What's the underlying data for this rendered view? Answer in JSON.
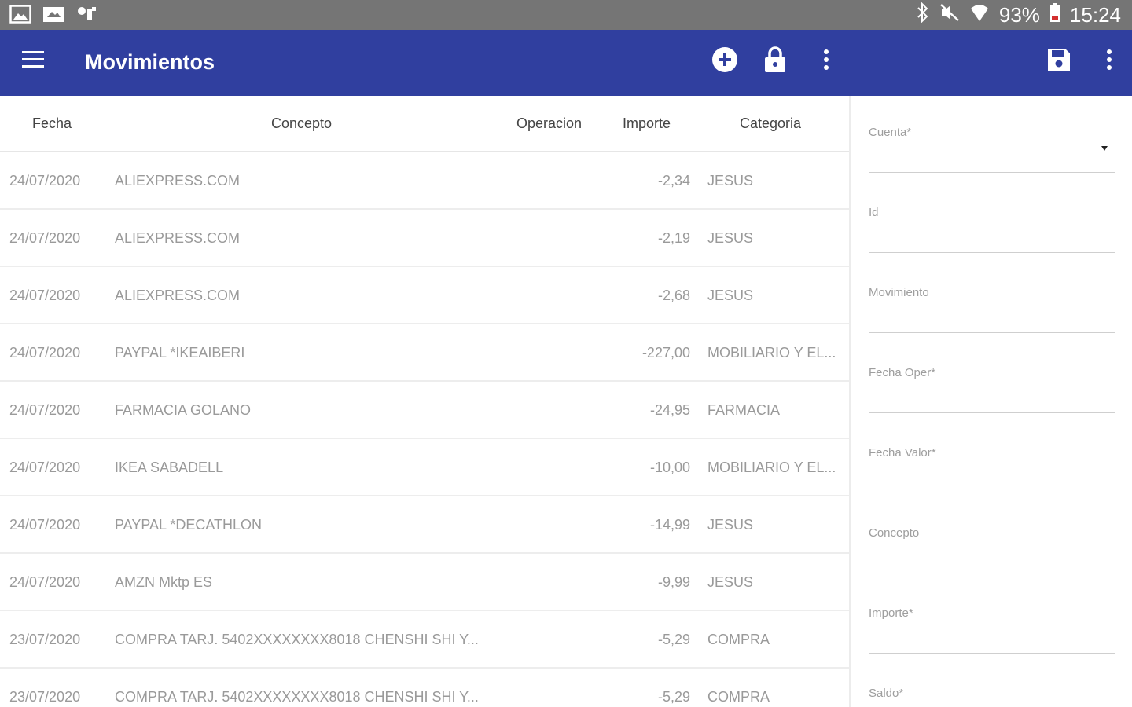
{
  "status_bar": {
    "battery": "93%",
    "time": "15:24",
    "left_icons": [
      "gallery-icon",
      "photo-icon",
      "sync-icon"
    ],
    "right_icons": [
      "bluetooth-icon",
      "mute-icon",
      "wifi-icon",
      "battery-icon"
    ]
  },
  "app_bar": {
    "title": "Movimientos",
    "color": "#303F9F",
    "actions": [
      "add-icon",
      "lock-icon",
      "more-icon",
      "save-icon",
      "more-icon"
    ]
  },
  "table": {
    "headers": {
      "fecha": "Fecha",
      "concepto": "Concepto",
      "operacion": "Operacion",
      "importe": "Importe",
      "categoria": "Categoria"
    },
    "rows": [
      {
        "fecha": "24/07/2020",
        "concepto": "ALIEXPRESS.COM",
        "importe": "-2,34",
        "categoria": "JESUS"
      },
      {
        "fecha": "24/07/2020",
        "concepto": "ALIEXPRESS.COM",
        "importe": "-2,19",
        "categoria": "JESUS"
      },
      {
        "fecha": "24/07/2020",
        "concepto": "ALIEXPRESS.COM",
        "importe": "-2,68",
        "categoria": "JESUS"
      },
      {
        "fecha": "24/07/2020",
        "concepto": "PAYPAL *IKEAIBERI",
        "importe": "-227,00",
        "categoria": "MOBILIARIO Y EL..."
      },
      {
        "fecha": "24/07/2020",
        "concepto": "FARMACIA GOLANO",
        "importe": "-24,95",
        "categoria": "FARMACIA"
      },
      {
        "fecha": "24/07/2020",
        "concepto": "IKEA SABADELL",
        "importe": "-10,00",
        "categoria": "MOBILIARIO Y EL..."
      },
      {
        "fecha": "24/07/2020",
        "concepto": "PAYPAL *DECATHLON",
        "importe": "-14,99",
        "categoria": "JESUS"
      },
      {
        "fecha": "24/07/2020",
        "concepto": "AMZN Mktp ES",
        "importe": "-9,99",
        "categoria": "JESUS"
      },
      {
        "fecha": "23/07/2020",
        "concepto": "COMPRA TARJ. 5402XXXXXXXX8018 CHENSHI SHI Y...",
        "importe": "-5,29",
        "categoria": "COMPRA"
      },
      {
        "fecha": "23/07/2020",
        "concepto": "COMPRA TARJ. 5402XXXXXXXX8018 CHENSHI SHI Y...",
        "importe": "-5,29",
        "categoria": "COMPRA"
      }
    ]
  },
  "form": {
    "fields": [
      {
        "label": "Cuenta*",
        "dropdown": true
      },
      {
        "label": "Id"
      },
      {
        "label": "Movimiento"
      },
      {
        "label": "Fecha Oper*"
      },
      {
        "label": "Fecha Valor*"
      },
      {
        "label": "Concepto"
      },
      {
        "label": "Importe*"
      },
      {
        "label": "Saldo*"
      }
    ]
  }
}
